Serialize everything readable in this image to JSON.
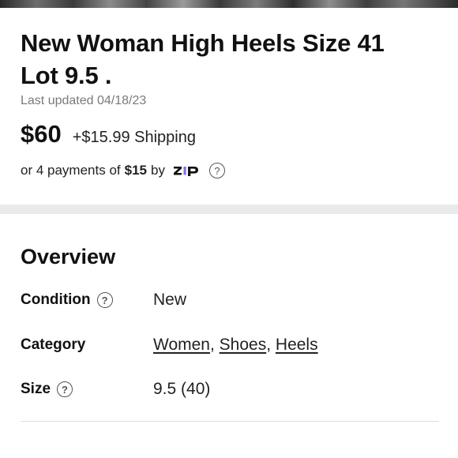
{
  "listing": {
    "title": "New Woman High Heels Size 41\nLot  9.5 .",
    "last_updated": "Last updated 04/18/23",
    "price": "$60",
    "shipping": "+$15.99 Shipping",
    "payments_prefix": "or 4 payments of",
    "payments_amount": "$15",
    "payments_by": "by",
    "payment_provider_icon": "zip-logo-icon",
    "help_icon": "question-circle-icon",
    "help_glyph": "?"
  },
  "overview": {
    "title": "Overview",
    "condition_label": "Condition",
    "condition_value": "New",
    "category_label": "Category",
    "category_links": [
      "Women",
      "Shoes",
      "Heels"
    ],
    "category_separator": ",",
    "size_label": "Size",
    "size_value": "9.5 (40)"
  },
  "colors": {
    "zip_purple": "#8a6af1",
    "text_dark": "#111111",
    "text_muted": "#7a7a7a",
    "band_gray": "#e9eaec"
  }
}
